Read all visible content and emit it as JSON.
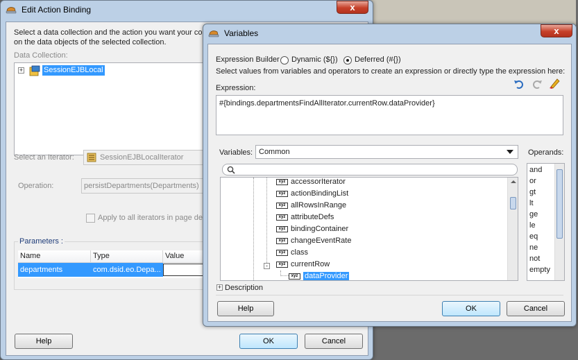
{
  "edit_action_binding": {
    "title": "Edit Action Binding",
    "close_glyph": "x",
    "instructions_line1": "Select a data collection and the action you want your co",
    "instructions_line2": "on the data objects of the selected collection.",
    "data_collection_label": "Data Collection:",
    "tree_root_label": "SessionEJBLocal",
    "iterator_label": "Select an Iterator:",
    "iterator_value": "SessionEJBLocalIterator",
    "operation_label": "Operation:",
    "operation_value": "persistDepartments(Departments)",
    "apply_all_label": "Apply to all iterators in page de",
    "parameters_legend": "Parameters :",
    "param_columns": [
      "Name",
      "Type",
      "Value"
    ],
    "param_row": {
      "name": "departments",
      "type": "com.dsid.eo.Depa...",
      "value": ""
    },
    "help_label": "Help",
    "ok_label": "OK",
    "cancel_label": "Cancel"
  },
  "variables": {
    "title": "Variables",
    "close_glyph": "x",
    "expression_builder_label": "Expression Builder",
    "radio_dynamic_label": "Dynamic (${})",
    "radio_deferred_label": "Deferred (#{})",
    "selected_mode": "deferred",
    "hint": "Select values from variables and operators to create an expression or directly type the expression here:",
    "expression_label": "Expression:",
    "expression_value": "#{bindings.departmentsFindAllIterator.currentRow.dataProvider}",
    "variables_label": "Variables:",
    "variables_select_value": "Common",
    "operands_label": "Operands:",
    "search_placeholder": "",
    "tree_items": [
      "accessorIterator",
      "actionBindingList",
      "allRowsInRange",
      "attributeDefs",
      "bindingContainer",
      "changeEventRate",
      "class",
      "currentRow",
      "dataProvider"
    ],
    "node_icon_text": "xyz",
    "operands": [
      "and",
      "or",
      "gt",
      "lt",
      "ge",
      "le",
      "eq",
      "ne",
      "not",
      "empty"
    ],
    "description_label": "Description",
    "help_label": "Help",
    "ok_label": "OK",
    "cancel_label": "Cancel"
  },
  "colors": {
    "selection": "#3399ff",
    "close_button": "#c6402a",
    "window_frame": "#bcd0e6",
    "client_bg": "#f0f0f0"
  }
}
